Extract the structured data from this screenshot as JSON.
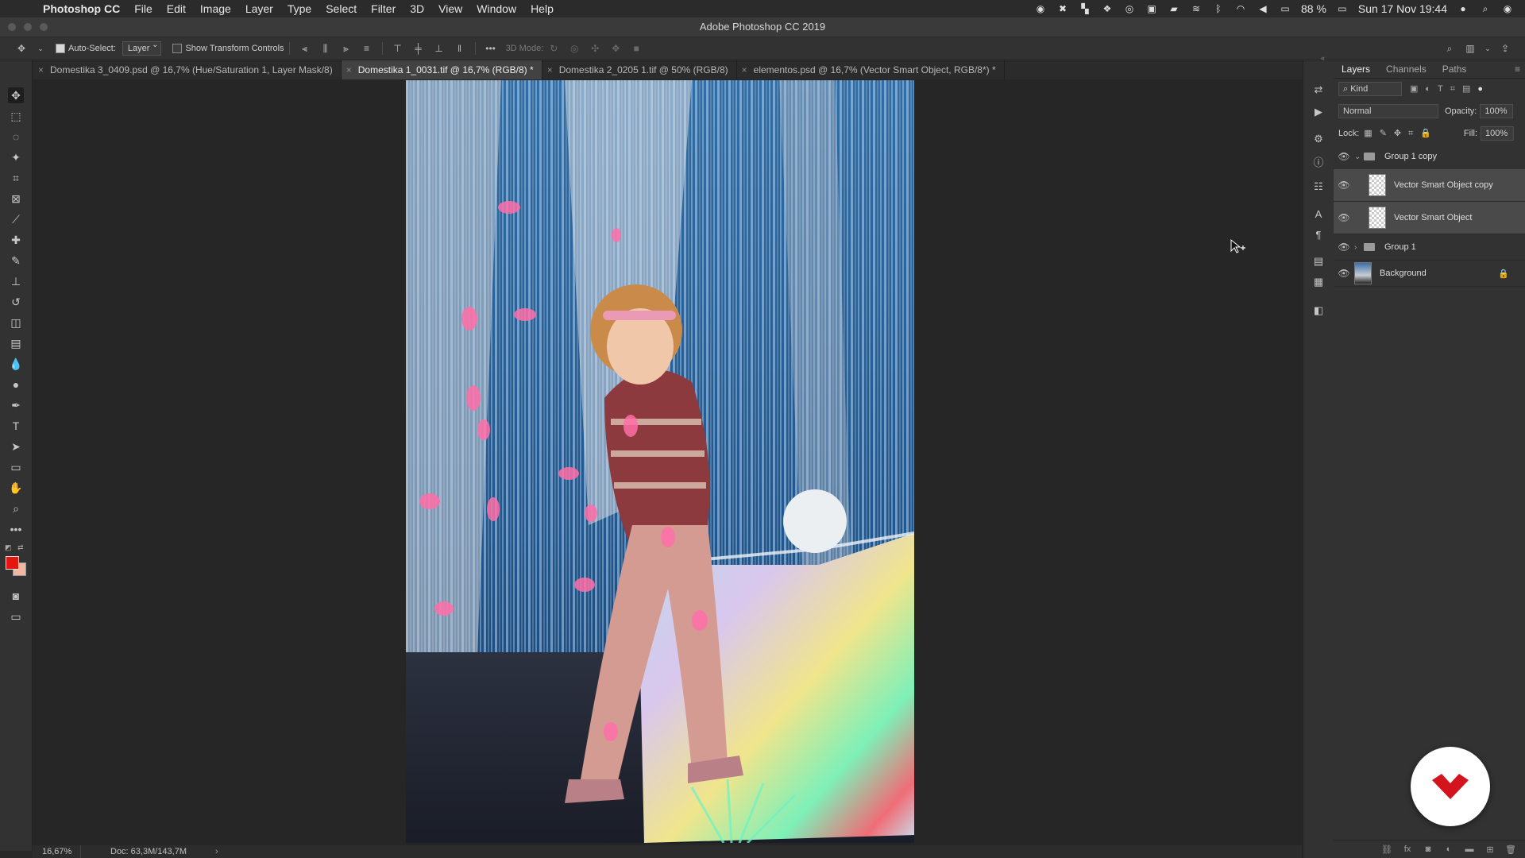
{
  "menubar": {
    "app_name": "Photoshop CC",
    "menus": [
      "File",
      "Edit",
      "Image",
      "Layer",
      "Type",
      "Select",
      "Filter",
      "3D",
      "View",
      "Window",
      "Help"
    ],
    "battery": "88 %",
    "clock": "Sun 17 Nov  19:44"
  },
  "window": {
    "title": "Adobe Photoshop CC 2019"
  },
  "options": {
    "auto_select_label": "Auto-Select:",
    "auto_select_checked": true,
    "auto_select_target": "Layer",
    "transform_label": "Show Transform Controls",
    "mode3d_label": "3D Mode:"
  },
  "tabs": [
    {
      "label": "Domestika 3_0409.psd @ 16,7% (Hue/Saturation 1, Layer Mask/8)"
    },
    {
      "label": "Domestika 1_0031.tif @ 16,7% (RGB/8) *"
    },
    {
      "label": "Domestika 2_0205 1.tif @ 50% (RGB/8)"
    },
    {
      "label": "elementos.psd @ 16,7% (Vector Smart Object, RGB/8*) *"
    }
  ],
  "active_tab": 1,
  "colors": {
    "foreground": "#e3170f",
    "background": "#f2b7a0",
    "accent_badge": "#d4141c"
  },
  "status": {
    "zoom": "16,67%",
    "doc": "Doc: 63,3M/143,7M"
  },
  "layers_panel": {
    "tabs": [
      "Layers",
      "Channels",
      "Paths"
    ],
    "filter_kind": "Kind",
    "blend_mode": "Normal",
    "opacity_label": "Opacity:",
    "opacity_value": "100%",
    "lock_label": "Lock:",
    "fill_label": "Fill:",
    "fill_value": "100%",
    "layers": [
      {
        "name": "Group 1 copy",
        "type": "group",
        "expanded": true,
        "indent": 0,
        "selected": false
      },
      {
        "name": "Vector Smart Object copy",
        "type": "smart-object",
        "indent": 1,
        "selected": true
      },
      {
        "name": "Vector Smart Object",
        "type": "smart-object",
        "indent": 1,
        "selected": true
      },
      {
        "name": "Group 1",
        "type": "group",
        "expanded": false,
        "indent": 0,
        "selected": false
      },
      {
        "name": "Background",
        "type": "image",
        "indent": 0,
        "selected": false,
        "locked": true
      }
    ]
  },
  "icons": {
    "tools": [
      "move-icon",
      "marquee-icon",
      "lasso-icon",
      "magic-wand-icon",
      "crop-icon",
      "frame-icon",
      "eyedropper-icon",
      "healing-brush-icon",
      "brush-icon",
      "clone-stamp-icon",
      "history-brush-icon",
      "eraser-icon",
      "gradient-icon",
      "blur-icon",
      "dodge-icon",
      "pen-icon",
      "type-icon",
      "path-selection-icon",
      "rectangle-icon",
      "hand-icon",
      "zoom-icon",
      "more-tools-icon"
    ]
  }
}
